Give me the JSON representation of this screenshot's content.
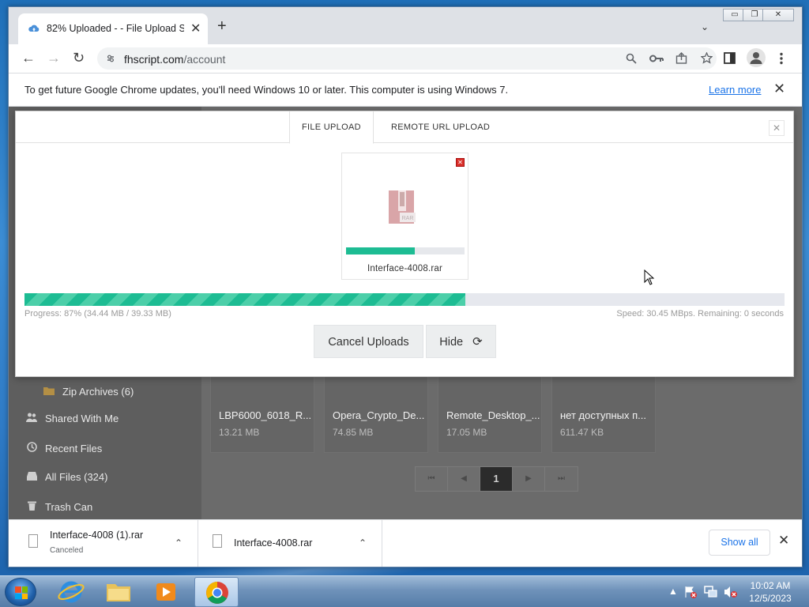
{
  "window": {
    "controls": {
      "minimize": "▭",
      "restore": "❐",
      "close": "✕"
    }
  },
  "tab": {
    "title": "82% Uploaded - - File Upload Sc",
    "close": "✕",
    "new_tab": "+",
    "menu": "⌄"
  },
  "toolbar": {
    "back": "←",
    "forward": "→",
    "reload": "↻",
    "url_host": "fhscript.com",
    "url_path": "/account"
  },
  "infobar": {
    "message": "To get future Google Chrome updates, you'll need Windows 10 or later. This computer is using Windows 7.",
    "link": "Learn more",
    "close": "✕"
  },
  "sidebar": {
    "items": [
      {
        "label": "Zip Archives (6)",
        "icon": "folder-icon"
      },
      {
        "label": "Shared With Me",
        "icon": "users-icon"
      },
      {
        "label": "Recent Files",
        "icon": "clock-icon"
      },
      {
        "label": "All Files (324)",
        "icon": "drive-icon"
      },
      {
        "label": "Trash Can",
        "icon": "trash-icon"
      }
    ]
  },
  "files": [
    {
      "name": "LBP6000_6018_R...",
      "size": "13.21 MB"
    },
    {
      "name": "Opera_Crypto_De...",
      "size": "74.85 MB"
    },
    {
      "name": "Remote_Desktop_...",
      "size": "17.05 MB"
    },
    {
      "name": "нет доступных п...",
      "size": "611.47 KB"
    }
  ],
  "pagination": {
    "first": "⏮",
    "prev": "◀",
    "current": "1",
    "next": "▶",
    "last": "⏭"
  },
  "modal": {
    "tabs": [
      "FILE UPLOAD",
      "REMOTE URL UPLOAD"
    ],
    "close": "✕",
    "item": {
      "filename": "Interface-4008.rar",
      "progress": 0.58,
      "remove": "✕",
      "icon_text": "RAR"
    },
    "overall_progress": 0.58,
    "progress_text": "Progress: 87% (34.44 MB / 39.33 MB)",
    "speed_text": "Speed: 30.45 MBps. Remaining: 0 seconds",
    "cancel_label": "Cancel Uploads",
    "hide_label": "Hide",
    "hide_icon": "⟳",
    "colors": {
      "progress": "#1dbc93",
      "track": "#e6e8ee"
    }
  },
  "downloads": {
    "items": [
      {
        "name": "Interface-4008 (1).rar",
        "status": "Canceled"
      },
      {
        "name": "Interface-4008.rar",
        "status": ""
      }
    ],
    "chevron": "⌃",
    "show_all": "Show all",
    "close": "✕"
  },
  "taskbar": {
    "time": "10:02 AM",
    "date": "12/5/2023",
    "tray_arrow": "▲"
  }
}
